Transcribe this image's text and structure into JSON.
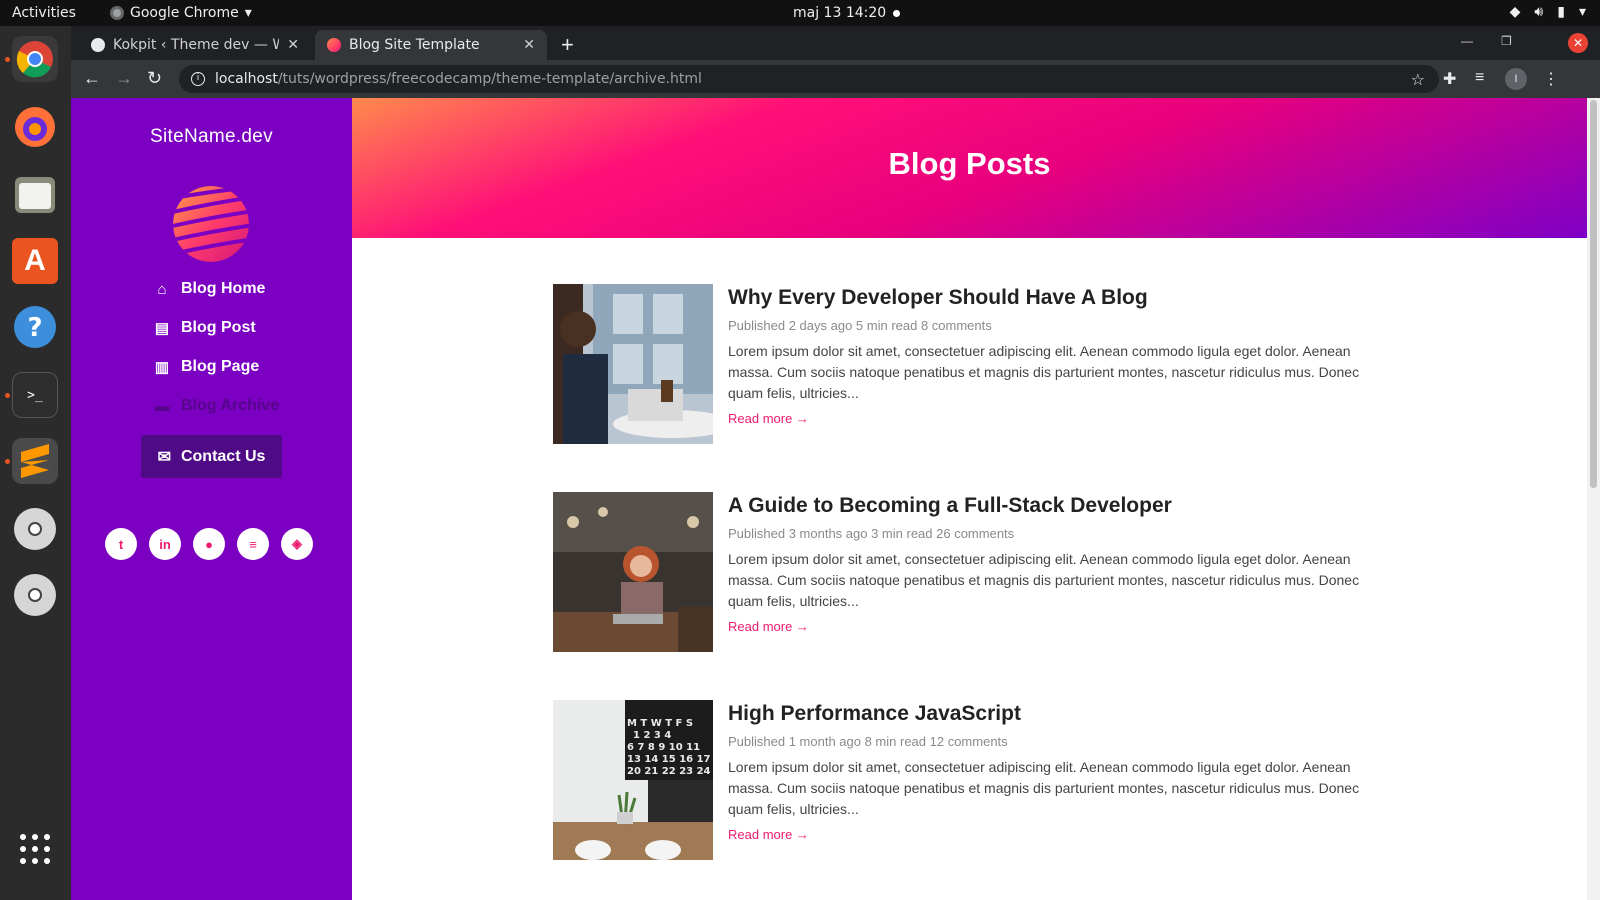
{
  "topbar": {
    "activities": "Activities",
    "app_name": "Google Chrome",
    "clock": "maj 13  14:20"
  },
  "browser": {
    "tabs": [
      {
        "title": "Kokpit ‹ Theme dev — Wo",
        "active": false
      },
      {
        "title": "Blog Site Template",
        "active": true
      }
    ],
    "url_host": "localhost",
    "url_path": "/tuts/wordpress/freecodecamp/theme-template/archive.html",
    "profile_initial": "I"
  },
  "sidebar": {
    "site_name": "SiteName.dev",
    "nav": [
      {
        "label": "Blog Home",
        "icon": "home-icon"
      },
      {
        "label": "Blog Post",
        "icon": "file-icon"
      },
      {
        "label": "Blog Page",
        "icon": "file-alt-icon"
      },
      {
        "label": "Blog Archive",
        "icon": "archive-icon"
      }
    ],
    "contact_label": "Contact Us",
    "social": [
      "twitter-icon",
      "linkedin-icon",
      "github-icon",
      "stackoverflow-icon",
      "codepen-icon"
    ]
  },
  "hero": {
    "title": "Blog Posts"
  },
  "posts": [
    {
      "title": "Why Every Developer Should Have A Blog",
      "meta": "Published 2 days ago 5 min read 8 comments",
      "excerpt": "Lorem ipsum dolor sit amet, consectetuer adipiscing elit. Aenean commodo ligula eget dolor. Aenean massa. Cum sociis natoque penatibus et magnis dis parturient montes, nascetur ridiculus mus. Donec quam felis, ultricies...",
      "read_more": "Read more →"
    },
    {
      "title": "A Guide to Becoming a Full-Stack Developer",
      "meta": "Published 3 months ago 3 min read 26 comments",
      "excerpt": "Lorem ipsum dolor sit amet, consectetuer adipiscing elit. Aenean commodo ligula eget dolor. Aenean massa. Cum sociis natoque penatibus et magnis dis parturient montes, nascetur ridiculus mus. Donec quam felis, ultricies...",
      "read_more": "Read more →"
    },
    {
      "title": "High Performance JavaScript",
      "meta": "Published 1 month ago 8 min read 12 comments",
      "excerpt": "Lorem ipsum dolor sit amet, consectetuer adipiscing elit. Aenean commodo ligula eget dolor. Aenean massa. Cum sociis natoque penatibus et magnis dis parturient montes, nascetur ridiculus mus. Donec quam felis, ultricies...",
      "read_more": "Read more →"
    }
  ],
  "colors": {
    "sidebar": "#7b00c1",
    "accent": "#ed1b6f",
    "contact_bg": "#4f0a86"
  }
}
